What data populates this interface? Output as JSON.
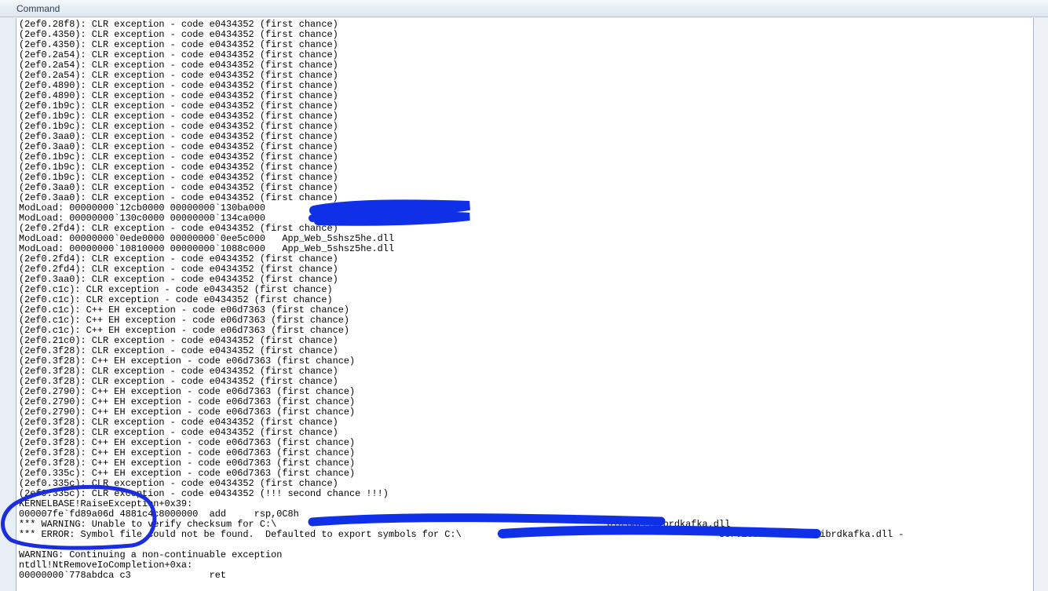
{
  "window": {
    "title": "Command"
  },
  "output_lines": [
    "(2ef0.28f8): CLR exception - code e0434352 (first chance)",
    "(2ef0.4350): CLR exception - code e0434352 (first chance)",
    "(2ef0.4350): CLR exception - code e0434352 (first chance)",
    "(2ef0.2a54): CLR exception - code e0434352 (first chance)",
    "(2ef0.2a54): CLR exception - code e0434352 (first chance)",
    "(2ef0.2a54): CLR exception - code e0434352 (first chance)",
    "(2ef0.4890): CLR exception - code e0434352 (first chance)",
    "(2ef0.4890): CLR exception - code e0434352 (first chance)",
    "(2ef0.1b9c): CLR exception - code e0434352 (first chance)",
    "(2ef0.1b9c): CLR exception - code e0434352 (first chance)",
    "(2ef0.1b9c): CLR exception - code e0434352 (first chance)",
    "(2ef0.3aa0): CLR exception - code e0434352 (first chance)",
    "(2ef0.3aa0): CLR exception - code e0434352 (first chance)",
    "(2ef0.1b9c): CLR exception - code e0434352 (first chance)",
    "(2ef0.1b9c): CLR exception - code e0434352 (first chance)",
    "(2ef0.1b9c): CLR exception - code e0434352 (first chance)",
    "(2ef0.3aa0): CLR exception - code e0434352 (first chance)",
    "(2ef0.3aa0): CLR exception - code e0434352 (first chance)",
    "ModLoad: 00000000`12cb0000 00000000`130ba000                          .API.dll",
    "ModLoad: 00000000`130c0000 00000000`134ca000                          .API.dll",
    "(2ef0.2fd4): CLR exception - code e0434352 (first chance)",
    "ModLoad: 00000000`0ede0000 00000000`0ee5c000   App_Web_5shsz5he.dll",
    "ModLoad: 00000000`10810000 00000000`1088c000   App_Web_5shsz5he.dll",
    "(2ef0.2fd4): CLR exception - code e0434352 (first chance)",
    "(2ef0.2fd4): CLR exception - code e0434352 (first chance)",
    "(2ef0.3aa0): CLR exception - code e0434352 (first chance)",
    "(2ef0.c1c): CLR exception - code e0434352 (first chance)",
    "(2ef0.c1c): CLR exception - code e0434352 (first chance)",
    "(2ef0.c1c): C++ EH exception - code e06d7363 (first chance)",
    "(2ef0.c1c): C++ EH exception - code e06d7363 (first chance)",
    "(2ef0.c1c): C++ EH exception - code e06d7363 (first chance)",
    "(2ef0.21c0): CLR exception - code e0434352 (first chance)",
    "(2ef0.3f28): CLR exception - code e0434352 (first chance)",
    "(2ef0.3f28): C++ EH exception - code e06d7363 (first chance)",
    "(2ef0.3f28): CLR exception - code e0434352 (first chance)",
    "(2ef0.3f28): CLR exception - code e0434352 (first chance)",
    "(2ef0.2790): C++ EH exception - code e06d7363 (first chance)",
    "(2ef0.2790): C++ EH exception - code e06d7363 (first chance)",
    "(2ef0.2790): C++ EH exception - code e06d7363 (first chance)",
    "(2ef0.3f28): CLR exception - code e0434352 (first chance)",
    "(2ef0.3f28): CLR exception - code e0434352 (first chance)",
    "(2ef0.3f28): C++ EH exception - code e06d7363 (first chance)",
    "(2ef0.3f28): C++ EH exception - code e06d7363 (first chance)",
    "(2ef0.3f28): C++ EH exception - code e06d7363 (first chance)",
    "(2ef0.335c): C++ EH exception - code e06d7363 (first chance)",
    "(2ef0.335c): CLR exception - code e0434352 (first chance)",
    "(2ef0.335c): CLR exception - code e0434352 (!!! second chance !!!)",
    "KERNELBASE!RaiseException+0x39:",
    "000007fe`fd89a06d 4881c4c8000000  add     rsp,0C8h",
    "*** WARNING: Unable to verify checksum for C:\\                                                           bin\\x64\\librdkafka.dll",
    "*** ERROR: Symbol file could not be found.  Defaulted to export symbols for C:\\                                              Services\\bin\\x64\\librdkafka.dll -",
    "",
    "WARNING: Continuing a non-continuable exception",
    "ntdll!NtRemoveIoCompletion+0xa:",
    "00000000`778abdca c3              ret"
  ],
  "annotation": {
    "ink_color": "#1a2de0",
    "redaction_color": "#1030e8"
  }
}
